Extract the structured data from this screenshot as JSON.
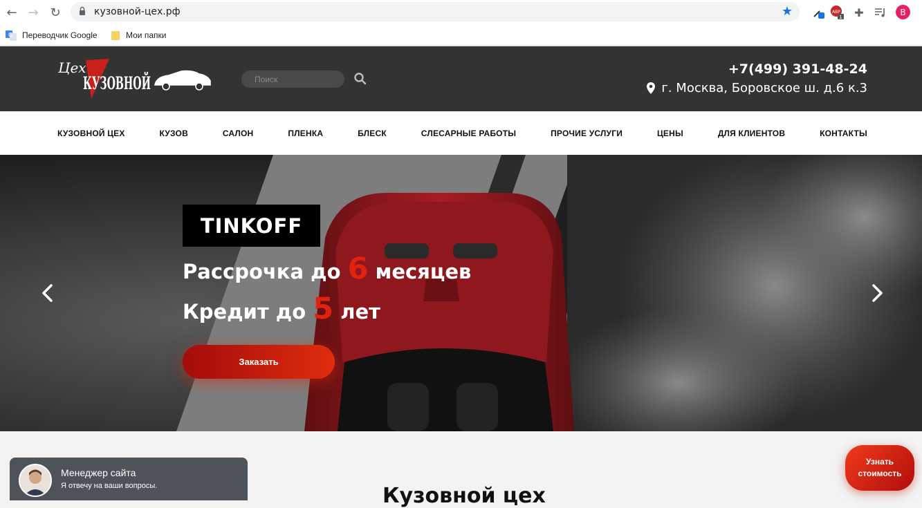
{
  "browser": {
    "url": "кузовной-цех.рф",
    "bookmarks": [
      "Переводчик Google",
      "Мои папки"
    ],
    "profile_initial": "B",
    "abp_label": "ABP",
    "abp_count": "1"
  },
  "header": {
    "logo_small": "Цех",
    "logo_big": "КУЗОВНОЙ",
    "search_placeholder": "Поиск",
    "phone": "+7(499) 391-48-24",
    "address": "г. Москва, Боровское ш. д.6 к.3"
  },
  "nav": {
    "items": [
      "КУЗОВНОЙ ЦЕХ",
      "КУЗОВ",
      "САЛОН",
      "ПЛЕНКА",
      "БЛЕСК",
      "СЛЕСАРНЫЕ РАБОТЫ",
      "ПРОЧИЕ УСЛУГИ",
      "ЦЕНЫ",
      "ДЛЯ КЛИЕНТОВ",
      "КОНТАКТЫ"
    ]
  },
  "hero": {
    "brand": "TINKOFF",
    "line1_pre": "Рассрочка до",
    "line1_num": "6",
    "line1_post": "месяцев",
    "line2_pre": "Кредит до",
    "line2_num": "5",
    "line2_post": "лет",
    "cta": "Заказать"
  },
  "content": {
    "section_title": "Кузовной цех"
  },
  "chat": {
    "title": "Менеджер сайта",
    "subtitle": "Я отвечу на ваши вопросы."
  },
  "cost_button": {
    "line1": "Узнать",
    "line2": "стоимость"
  },
  "colors": {
    "header_bg": "#333333",
    "accent_red": "#e0230c",
    "chrome_star": "#1a73e8"
  }
}
